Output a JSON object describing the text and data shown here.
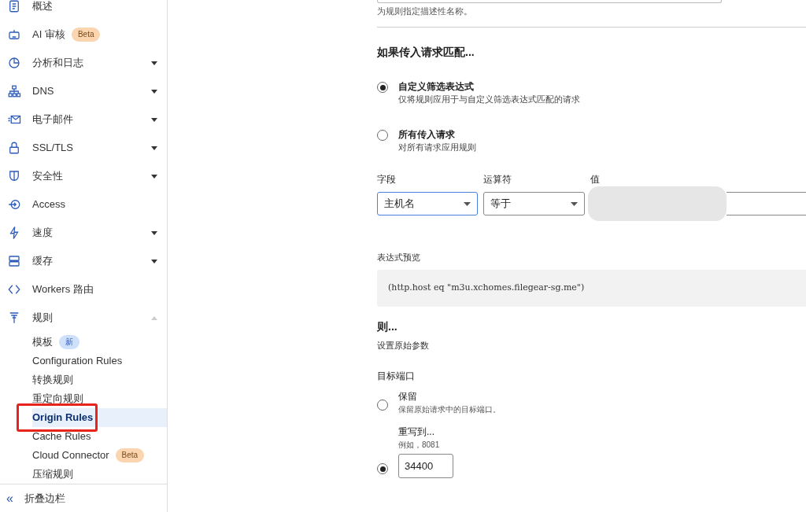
{
  "sidebar": {
    "items": [
      {
        "label": "概述"
      },
      {
        "label": "AI 审核",
        "badge": {
          "text": "Beta",
          "kind": "beta"
        }
      },
      {
        "label": "分析和日志",
        "expanded": false
      },
      {
        "label": "DNS",
        "expanded": false
      },
      {
        "label": "电子邮件",
        "expanded": false
      },
      {
        "label": "SSL/TLS",
        "expanded": false
      },
      {
        "label": "安全性",
        "expanded": false
      },
      {
        "label": "Access"
      },
      {
        "label": "速度",
        "expanded": false
      },
      {
        "label": "缓存",
        "expanded": false
      },
      {
        "label": "Workers 路由"
      },
      {
        "label": "规则",
        "expanded": true,
        "children": [
          {
            "label": "模板",
            "selected": false,
            "badge": {
              "text": "新",
              "kind": "new"
            }
          },
          {
            "label": "Configuration Rules",
            "selected": false
          },
          {
            "label": "转换规则",
            "selected": false
          },
          {
            "label": "重定向规则",
            "selected": false
          },
          {
            "label": "Origin Rules",
            "selected": true,
            "highlighted": true
          },
          {
            "label": "Cache Rules",
            "selected": false
          },
          {
            "label": "Cloud Connector",
            "selected": false,
            "badge": {
              "text": "Beta",
              "kind": "beta"
            }
          },
          {
            "label": "压缩规则",
            "selected": false
          }
        ]
      }
    ],
    "collapse": {
      "icon": "«",
      "label": "折叠边栏"
    }
  },
  "name_help": "为规则指定描述性名称。",
  "match": {
    "heading": "如果传入请求匹配...",
    "options": [
      {
        "label": "自定义筛选表达式",
        "description": "仅将规则应用于与自定义筛选表达式匹配的请求",
        "selected": true
      },
      {
        "label": "所有传入请求",
        "description": "对所有请求应用规则",
        "selected": false
      }
    ],
    "filter": {
      "field_label": "字段",
      "field_value": "主机名",
      "operator_label": "运算符",
      "operator_value": "等于",
      "value_label": "值"
    },
    "preview_label": "表达式预览",
    "preview": "(http.host eq \"m3u.xchomes.filegear-sg.me\")"
  },
  "then": {
    "heading": "则...",
    "subtitle": "设置原始参数",
    "port_label": "目标端口",
    "options": [
      {
        "label": "保留",
        "description": "保留原始请求中的目标端口。",
        "selected": false
      },
      {
        "label": "重写到...",
        "description": "例如，8081",
        "selected": true,
        "value": "34400"
      }
    ]
  }
}
